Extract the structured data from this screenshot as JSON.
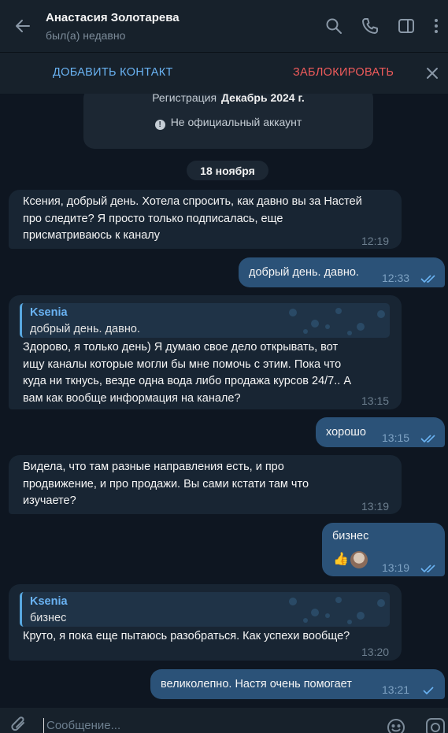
{
  "header": {
    "back_icon": "arrow-left-icon",
    "name": "Анастасия Золотарева",
    "status": "был(а) недавно",
    "icons": [
      "search-icon",
      "phone-icon",
      "sidebar-icon",
      "more-vert-icon"
    ]
  },
  "actionbar": {
    "add_contact": "ДОБАВИТЬ КОНТАКТ",
    "block": "ЗАБЛОКИРОВАТЬ",
    "close_icon": "close-icon"
  },
  "info": {
    "reg_label": "Регистрация",
    "reg_value": "Декабрь 2024 г.",
    "unofficial": "Не официальный аккаунт"
  },
  "date": "18 ноября",
  "messages": [
    {
      "dir": "in",
      "lines": [
        "Ксения, добрый день. Хотела спросить, как давно вы за Настей",
        "про следите? Я просто только подписалась, еще",
        "присматриваюсь к каналу"
      ],
      "time": "12:19"
    },
    {
      "dir": "out",
      "text": "добрый день. давно.",
      "time": "12:33",
      "read": true
    },
    {
      "dir": "in",
      "reply": {
        "name": "Ksenia",
        "text": "добрый день. давно."
      },
      "lines": [
        "Здорово, я только день) Я думаю свое дело открывать, вот",
        "ищу каналы которые могли бы мне помочь с этим. Пока что",
        "куда ни ткнусь, везде одна вода либо продажа курсов 24/7.. А",
        "вам как вообще информация на канале?"
      ],
      "time": "13:15"
    },
    {
      "dir": "out",
      "text": "хорошо",
      "time": "13:15",
      "read": true
    },
    {
      "dir": "in",
      "lines": [
        "Видела, что там разные направления есть, и про",
        "продвижение, и про продажи. Вы сами кстати там что",
        "изучаете?"
      ],
      "time": "13:19"
    },
    {
      "dir": "out",
      "text": "бизнес",
      "time": "13:19",
      "read": true,
      "reaction": "👍"
    },
    {
      "dir": "in",
      "reply": {
        "name": "Ksenia",
        "text": "бизнес"
      },
      "lines": [
        "Круто, я пока еще пытаюсь разобраться. Как успехи вообще?"
      ],
      "time": "13:20"
    },
    {
      "dir": "out",
      "text": "великолепно. Настя очень помогает",
      "time": "13:21",
      "read": false
    }
  ],
  "composer": {
    "placeholder": "Сообщение...",
    "value": "",
    "icons": [
      "paperclip-icon",
      "emoji-icon",
      "camera-icon"
    ]
  },
  "colors": {
    "background": "#0e1621",
    "header": "#17212b",
    "incoming": "#182533",
    "outgoing": "#2b5278",
    "accent": "#6ab3f3",
    "danger": "#ef5b5b"
  }
}
